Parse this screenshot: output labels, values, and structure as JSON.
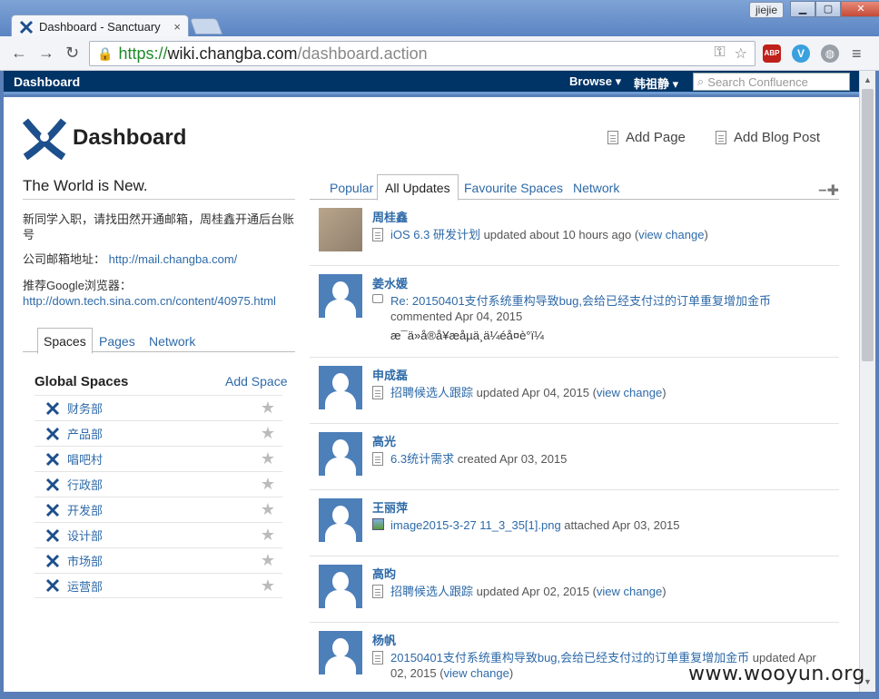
{
  "browser": {
    "tab_title": "Dashboard - Sanctuary",
    "tab_close": "×",
    "user_badge": "jiejie",
    "url_scheme": "https://",
    "url_host": "wiki.changba.com",
    "url_path": "/dashboard.action",
    "ext_abp": "ABP"
  },
  "header": {
    "dashboard_link": "Dashboard",
    "browse": "Browse ▾",
    "user": "韩祖静 ▾",
    "search_placeholder": "Search Confluence"
  },
  "page": {
    "title": "Dashboard",
    "add_page": "Add Page",
    "add_blog_post": "Add Blog Post"
  },
  "welcome": {
    "title": "The World is New.",
    "line1": "新同学入职，请找田然开通邮箱，周桂鑫开通后台账号",
    "mail_label": "公司邮箱地址：",
    "mail_url": "http://mail.changba.com/",
    "browser_label": "推荐Google浏览器：",
    "browser_url": "http://down.tech.sina.com.cn/content/40975.html"
  },
  "left_tabs": [
    "Spaces",
    "Pages",
    "Network"
  ],
  "global_spaces": {
    "title": "Global Spaces",
    "add_label": "Add Space",
    "items": [
      "财务部",
      "产品部",
      "唱吧村",
      "行政部",
      "开发部",
      "设计部",
      "市场部",
      "运营部"
    ]
  },
  "right_tabs": [
    "Popular",
    "All Updates",
    "Favourite Spaces",
    "Network"
  ],
  "tab_controls": "−✚",
  "updates": [
    {
      "user": "周桂鑫",
      "title": "iOS 6.3 研发计划",
      "action": " updated about 10 hours ago (",
      "link": "view change",
      "tail": ")"
    },
    {
      "user": "姜水媛",
      "title": "Re: 20150401支付系统重构导致bug,会给已经支付过的订单重复增加金币",
      "action": "commented Apr 04, 2015",
      "excerpt": "æ¯ä»å®å¥æåµä¸ä¼éå¤è°ï¼"
    },
    {
      "user": "申成磊",
      "title": "招聘候选人跟踪",
      "action": " updated Apr 04, 2015 (",
      "link": "view change",
      "tail": ")"
    },
    {
      "user": "高光",
      "title": "6.3统计需求",
      "action": " created Apr 03, 2015"
    },
    {
      "user": "王丽萍",
      "title": "image2015-3-27 11_3_35[1].png",
      "action": " attached Apr 03, 2015"
    },
    {
      "user": "高昀",
      "title": "招聘候选人跟踪",
      "action": " updated Apr 02, 2015 (",
      "link": "view change",
      "tail": ")"
    },
    {
      "user": "杨帆",
      "title": "20150401支付系统重构导致bug,会给已经支付过的订单重复增加金币",
      "action": " updated Apr 02, 2015 (",
      "link": "view change",
      "tail": ")"
    }
  ],
  "watermark": "www.wooyun.org"
}
